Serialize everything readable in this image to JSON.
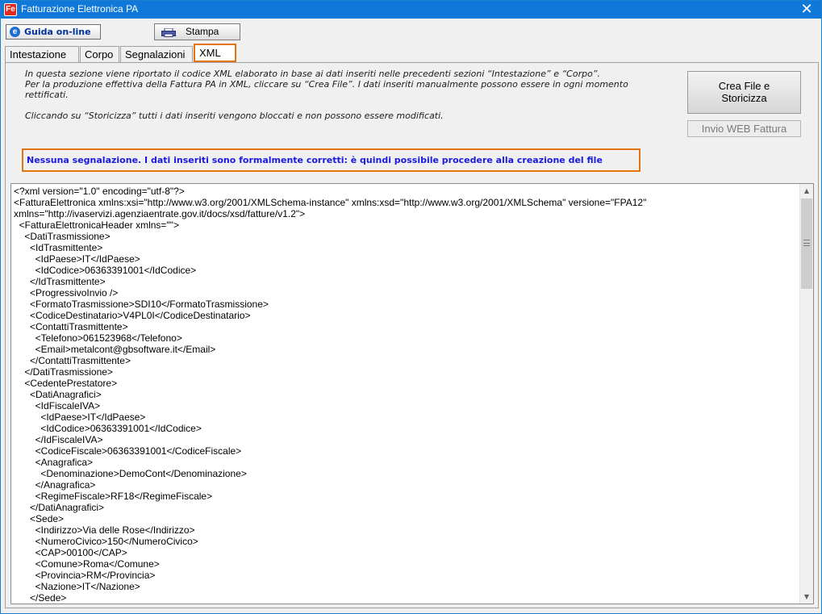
{
  "window": {
    "title": "Fatturazione Elettronica PA",
    "app_icon": "Fe",
    "close_symbol": "✕"
  },
  "toolbar": {
    "guida_label": "Guida on-line",
    "guida_icon": "e",
    "stampa_label": "Stampa"
  },
  "tabs": [
    {
      "label": "Intestazione"
    },
    {
      "label": "Corpo"
    },
    {
      "label": "Segnalazioni"
    },
    {
      "label": "XML",
      "active": true
    }
  ],
  "info": {
    "line1": "In questa sezione viene riportato il codice XML elaborato in base ai dati inseriti nelle precedenti sezioni “Intestazione” e “Corpo”.",
    "line2": "Per la produzione effettiva della Fattura PA in XML, cliccare su “Crea File”. I dati inseriti manualmente possono essere in ogni momento",
    "line3": "rettificati.",
    "line4": "Cliccando su “Storicizza” tutti i dati inseriti vengono bloccati e non possono essere modificati."
  },
  "actions": {
    "crea_line1": "Crea File e",
    "crea_line2": "Storicizza",
    "invio_label": "Invio WEB Fattura"
  },
  "status_message": "Nessuna segnalazione. I dati inseriti sono formalmente corretti: è quindi possibile procedere alla  creazione del file",
  "xml_lines": [
    "<?xml version=\"1.0\" encoding=\"utf-8\"?>",
    "<FatturaElettronica xmlns:xsi=\"http://www.w3.org/2001/XMLSchema-instance\" xmlns:xsd=\"http://www.w3.org/2001/XMLSchema\" versione=\"FPA12\"",
    "xmlns=\"http://ivaservizi.agenziaentrate.gov.it/docs/xsd/fatture/v1.2\">",
    "  <FatturaElettronicaHeader xmlns=\"\">",
    "    <DatiTrasmissione>",
    "      <IdTrasmittente>",
    "        <IdPaese>IT</IdPaese>",
    "        <IdCodice>06363391001</IdCodice>",
    "      </IdTrasmittente>",
    "      <ProgressivoInvio />",
    "      <FormatoTrasmissione>SDI10</FormatoTrasmissione>",
    "      <CodiceDestinatario>V4PL0I</CodiceDestinatario>",
    "      <ContattiTrasmittente>",
    "        <Telefono>061523968</Telefono>",
    "        <Email>metalcont@gbsoftware.it</Email>",
    "      </ContattiTrasmittente>",
    "    </DatiTrasmissione>",
    "    <CedentePrestatore>",
    "      <DatiAnagrafici>",
    "        <IdFiscaleIVA>",
    "          <IdPaese>IT</IdPaese>",
    "          <IdCodice>06363391001</IdCodice>",
    "        </IdFiscaleIVA>",
    "        <CodiceFiscale>06363391001</CodiceFiscale>",
    "        <Anagrafica>",
    "          <Denominazione>DemoCont</Denominazione>",
    "        </Anagrafica>",
    "        <RegimeFiscale>RF18</RegimeFiscale>",
    "      </DatiAnagrafici>",
    "      <Sede>",
    "        <Indirizzo>Via delle Rose</Indirizzo>",
    "        <NumeroCivico>150</NumeroCivico>",
    "        <CAP>00100</CAP>",
    "        <Comune>Roma</Comune>",
    "        <Provincia>RM</Provincia>",
    "        <Nazione>IT</Nazione>",
    "      </Sede>"
  ],
  "scrollbar": {
    "up_symbol": "▲",
    "down_symbol": "▼"
  }
}
